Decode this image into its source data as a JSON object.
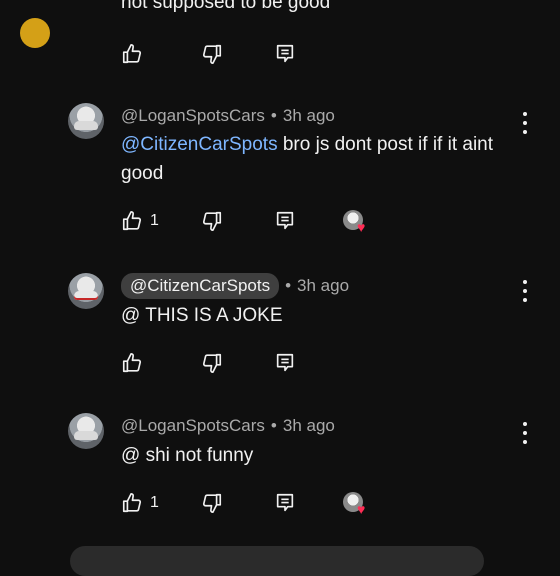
{
  "previous_comment": {
    "text": "not supposed to be good"
  },
  "comments": [
    {
      "author": "@LoganSpotsCars",
      "time": "3h ago",
      "mention": "@CitizenCarSpots",
      "text": "bro js dont post if if it aint good",
      "likes": "1",
      "creator_heart": true
    },
    {
      "author": "@CitizenCarSpots",
      "time": "3h ago",
      "text": "@ THIS IS A JOKE",
      "likes": "",
      "creator_heart": false
    },
    {
      "author": "@LoganSpotsCars",
      "time": "3h ago",
      "text": "@ shi not funny",
      "likes": "1",
      "creator_heart": true
    }
  ],
  "separator": "•",
  "heart_symbol": "♥",
  "colors": {
    "background": "#0f0f0f",
    "mention": "#7eb6ff",
    "heart": "#ff2d55",
    "muted": "#aaaaaa"
  }
}
